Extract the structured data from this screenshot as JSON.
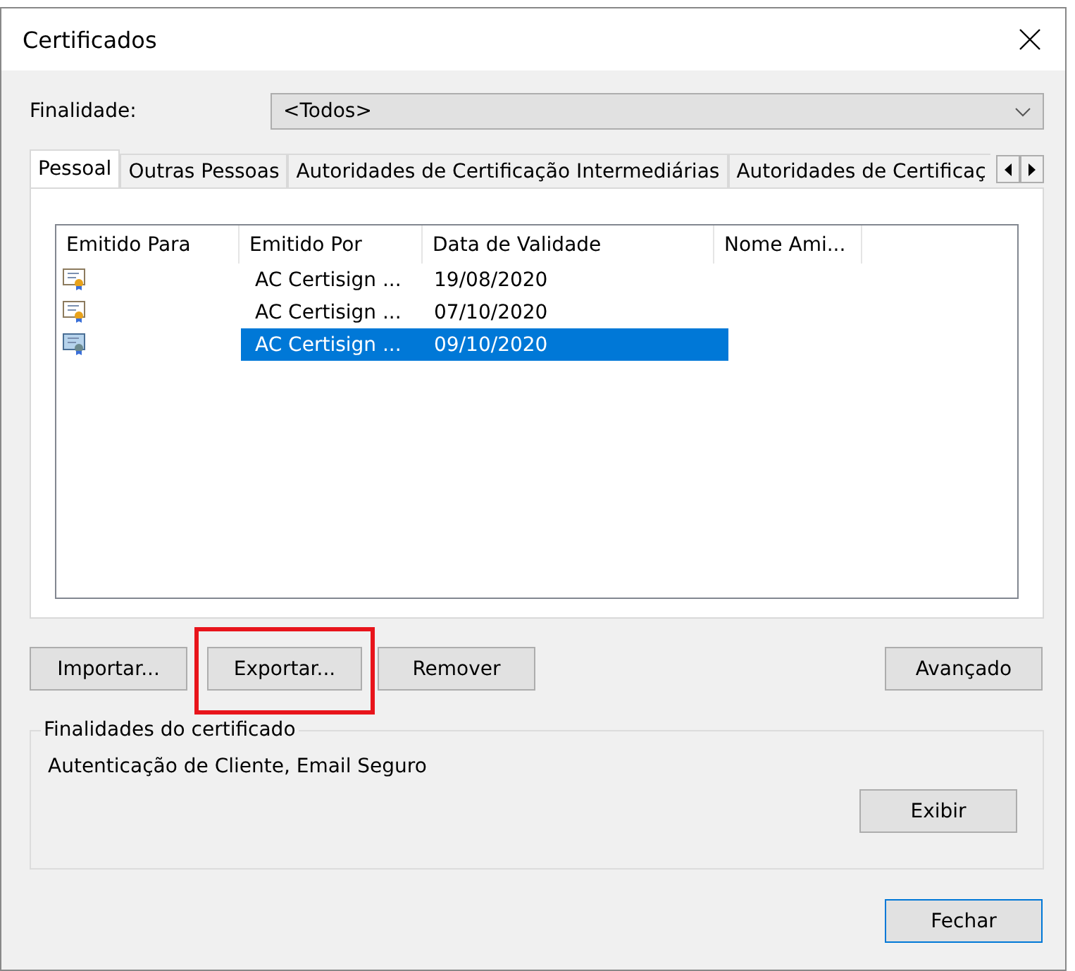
{
  "window": {
    "title": "Certificados"
  },
  "purpose": {
    "label": "Finalidade:",
    "value": "<Todos>"
  },
  "tabs": [
    {
      "label": "Pessoal",
      "selected": true
    },
    {
      "label": "Outras Pessoas",
      "selected": false
    },
    {
      "label": "Autoridades de Certificação Intermediárias",
      "selected": false
    },
    {
      "label": "Autoridades de Certificaç",
      "selected": false
    }
  ],
  "table": {
    "columns": [
      "Emitido Para",
      "Emitido Por",
      "Data de Validade",
      "Nome Ami..."
    ],
    "rows": [
      {
        "issued_by": "AC Certisign ...",
        "valid_until": "19/08/2020",
        "selected": false
      },
      {
        "issued_by": "AC Certisign ...",
        "valid_until": "07/10/2020",
        "selected": false
      },
      {
        "issued_by": "AC Certisign ...",
        "valid_until": "09/10/2020",
        "selected": true
      }
    ]
  },
  "actions": [
    {
      "label": "Importar...",
      "highlighted": false
    },
    {
      "label": "Exportar...",
      "highlighted": true
    },
    {
      "label": "Remover",
      "highlighted": false
    }
  ],
  "advanced_button": "Avançado",
  "purposes_group": {
    "title": "Finalidades do certificado",
    "text": "Autenticação de Cliente, Email Seguro",
    "button": "Exibir"
  },
  "close_button": "Fechar"
}
